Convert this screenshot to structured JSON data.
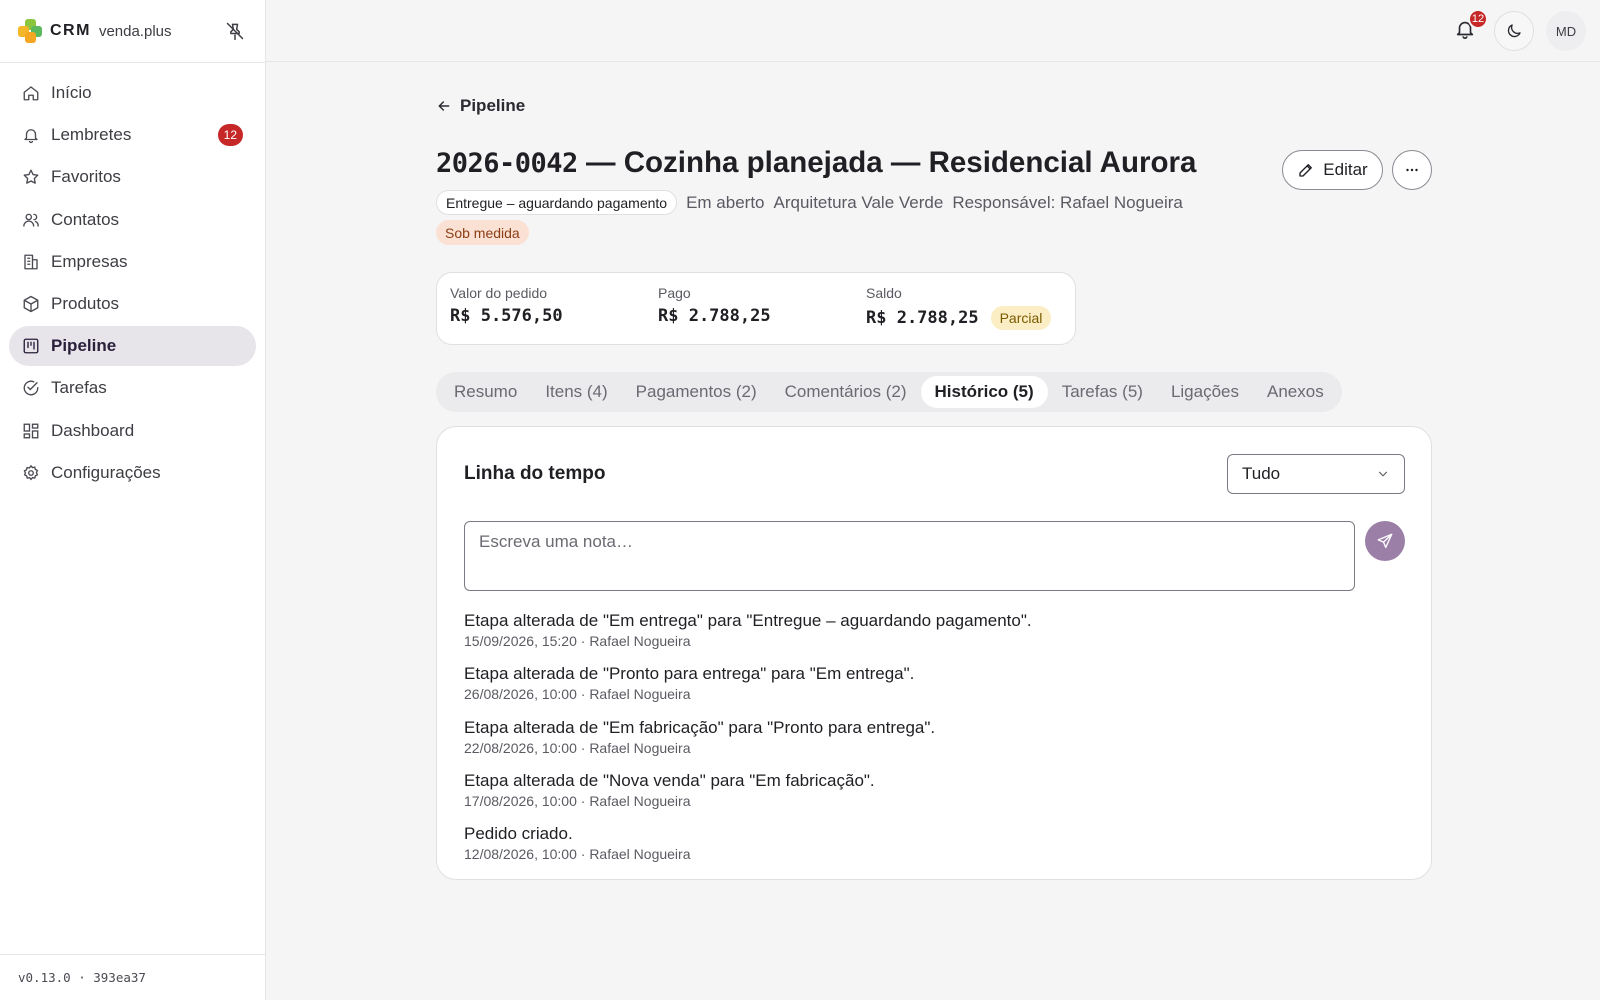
{
  "brand": {
    "name": "CRM",
    "subtitle": "venda.plus"
  },
  "sidebar": {
    "items": [
      {
        "label": "Início",
        "icon": "home-icon"
      },
      {
        "label": "Lembretes",
        "icon": "bell-icon",
        "badge": "12"
      },
      {
        "label": "Favoritos",
        "icon": "star-icon"
      },
      {
        "label": "Contatos",
        "icon": "users-icon"
      },
      {
        "label": "Empresas",
        "icon": "building-icon"
      },
      {
        "label": "Produtos",
        "icon": "package-icon"
      },
      {
        "label": "Pipeline",
        "icon": "kanban-icon",
        "active": true
      },
      {
        "label": "Tarefas",
        "icon": "check-circle-icon"
      },
      {
        "label": "Dashboard",
        "icon": "dashboard-icon"
      },
      {
        "label": "Configurações",
        "icon": "gear-icon"
      }
    ],
    "version": "v0.13.0 · 393ea37"
  },
  "topbar": {
    "notifications_count": "12",
    "avatar_initials": "MD"
  },
  "page": {
    "back_label": "Pipeline",
    "code": "2026-0042",
    "title_rest": " — Cozinha planejada — Residencial Aurora",
    "edit_label": "Editar",
    "stage": "Entregue – aguardando pagamento",
    "status": "Em aberto",
    "company": "Arquitetura Vale Verde",
    "owner": "Responsável: Rafael Nogueira",
    "tag": "Sob medida"
  },
  "money": {
    "order_label": "Valor do pedido",
    "order_value": "R$ 5.576,50",
    "paid_label": "Pago",
    "paid_value": "R$ 2.788,25",
    "balance_label": "Saldo",
    "balance_value": "R$ 2.788,25",
    "balance_status": "Parcial"
  },
  "tabs": [
    {
      "label": "Resumo"
    },
    {
      "label": "Itens (4)"
    },
    {
      "label": "Pagamentos (2)"
    },
    {
      "label": "Comentários (2)"
    },
    {
      "label": "Histórico (5)",
      "active": true
    },
    {
      "label": "Tarefas (5)"
    },
    {
      "label": "Ligações"
    },
    {
      "label": "Anexos"
    }
  ],
  "timeline": {
    "title": "Linha do tempo",
    "filter_value": "Tudo",
    "note_placeholder": "Escreva uma nota…",
    "events": [
      {
        "text": "Etapa alterada de \"Em entrega\" para \"Entregue – aguardando pagamento\".",
        "meta": "15/09/2026, 15:20 · Rafael Nogueira"
      },
      {
        "text": "Etapa alterada de \"Pronto para entrega\" para \"Em entrega\".",
        "meta": "26/08/2026, 10:00 · Rafael Nogueira"
      },
      {
        "text": "Etapa alterada de \"Em fabricação\" para \"Pronto para entrega\".",
        "meta": "22/08/2026, 10:00 · Rafael Nogueira"
      },
      {
        "text": "Etapa alterada de \"Nova venda\" para \"Em fabricação\".",
        "meta": "17/08/2026, 10:00 · Rafael Nogueira"
      },
      {
        "text": "Pedido criado.",
        "meta": "12/08/2026, 10:00 · Rafael Nogueira"
      }
    ]
  },
  "colors": {
    "accent": "#9b7fa7",
    "active_nav_bg": "#e7e4ea",
    "badge": "#c62828",
    "tag_bg": "#fbe1d3",
    "partial_bg": "#fbeec4"
  }
}
